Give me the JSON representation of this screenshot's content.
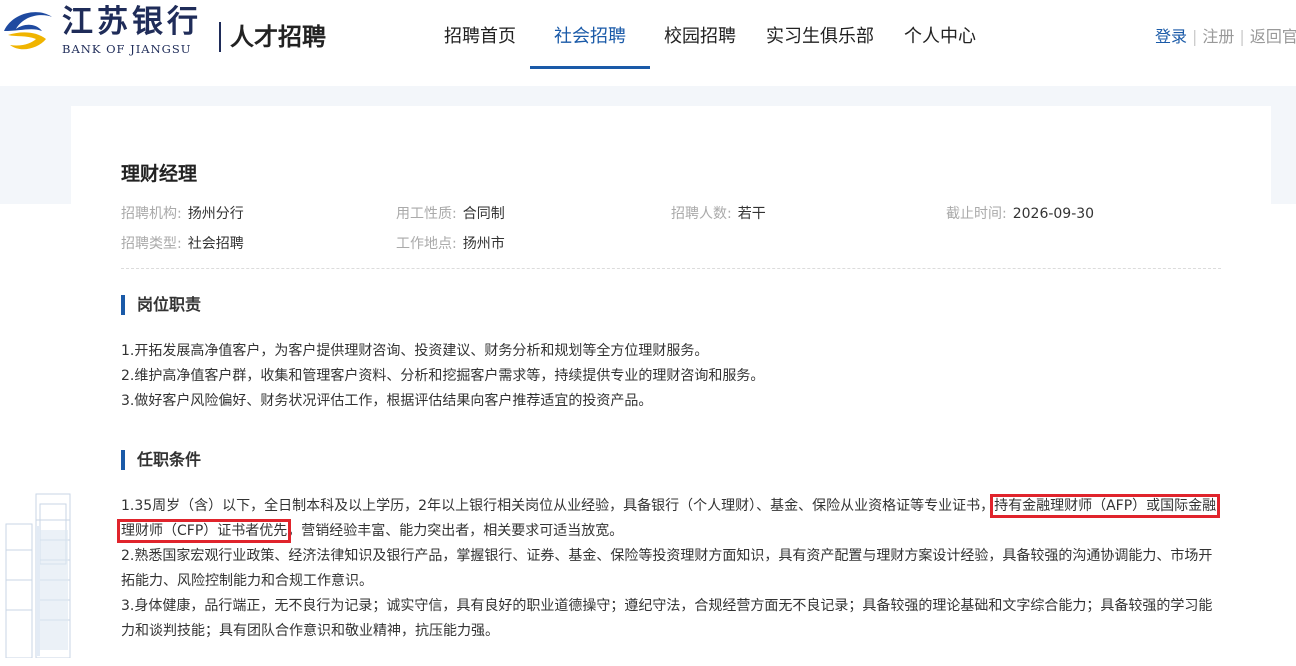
{
  "header": {
    "logo_cn": "江苏银行",
    "logo_en": "BANK OF JIANGSU",
    "site_title": "人才招聘",
    "nav": [
      {
        "label": "招聘首页"
      },
      {
        "label": "社会招聘"
      },
      {
        "label": "校园招聘"
      },
      {
        "label": "实习生俱乐部"
      },
      {
        "label": "个人中心"
      }
    ],
    "active_nav": "社会招聘",
    "login": "登录",
    "register": "注册",
    "back": "返回官"
  },
  "job": {
    "title": "理财经理",
    "org_label": "招聘机构:",
    "org": "扬州分行",
    "type_label": "用工性质:",
    "type": "合同制",
    "count_label": "招聘人数:",
    "count": "若干",
    "deadline_label": "截止时间:",
    "deadline": "2026-09-30",
    "category_label": "招聘类型:",
    "category": "社会招聘",
    "location_label": "工作地点:",
    "location": "扬州市"
  },
  "duties": {
    "heading": "岗位职责",
    "items": [
      "1.开拓发展高净值客户，为客户提供理财咨询、投资建议、财务分析和规划等全方位理财服务。",
      "2.维护高净值客户群，收集和管理客户资料、分析和挖掘客户需求等，持续提供专业的理财咨询和服务。",
      "3.做好客户风险偏好、财务状况评估工作，根据评估结果向客户推荐适宜的投资产品。"
    ]
  },
  "requirements": {
    "heading": "任职条件",
    "item1_a": "1.35周岁（含）以下，全日制本科及以上学历，2年以上银行相关岗位从业经验，具备银行（个人理财）、基金、保险从业资格证等专业证书，",
    "item1_hl1": "持有金融理财师（AFP）或国际金融",
    "item1_hl2": "理财师（CFP）证书者优先",
    "item1_b": "，营销经验丰富、能力突出者，相关要求可适当放宽。",
    "item2": "2.熟悉国家宏观行业政策、经济法律知识及银行产品，掌握银行、证券、基金、保险等投资理财方面知识，具有资产配置与理财方案设计经验，具备较强的沟通协调能力、市场开拓能力、风险控制能力和合规工作意识。",
    "item3": "3.身体健康，品行端正，无不良行为记录；诚实守信，具有良好的职业道德操守；遵纪守法，合规经营方面无不良记录；具备较强的理论基础和文字综合能力；具备较强的学习能力和谈判技能；具有团队合作意识和敬业精神，抗压能力强。"
  },
  "colors": {
    "brand_blue": "#1a5aa8",
    "logo_navy": "#1f2c59",
    "logo_gold": "#f0b400",
    "highlight_red": "#e0242c"
  }
}
